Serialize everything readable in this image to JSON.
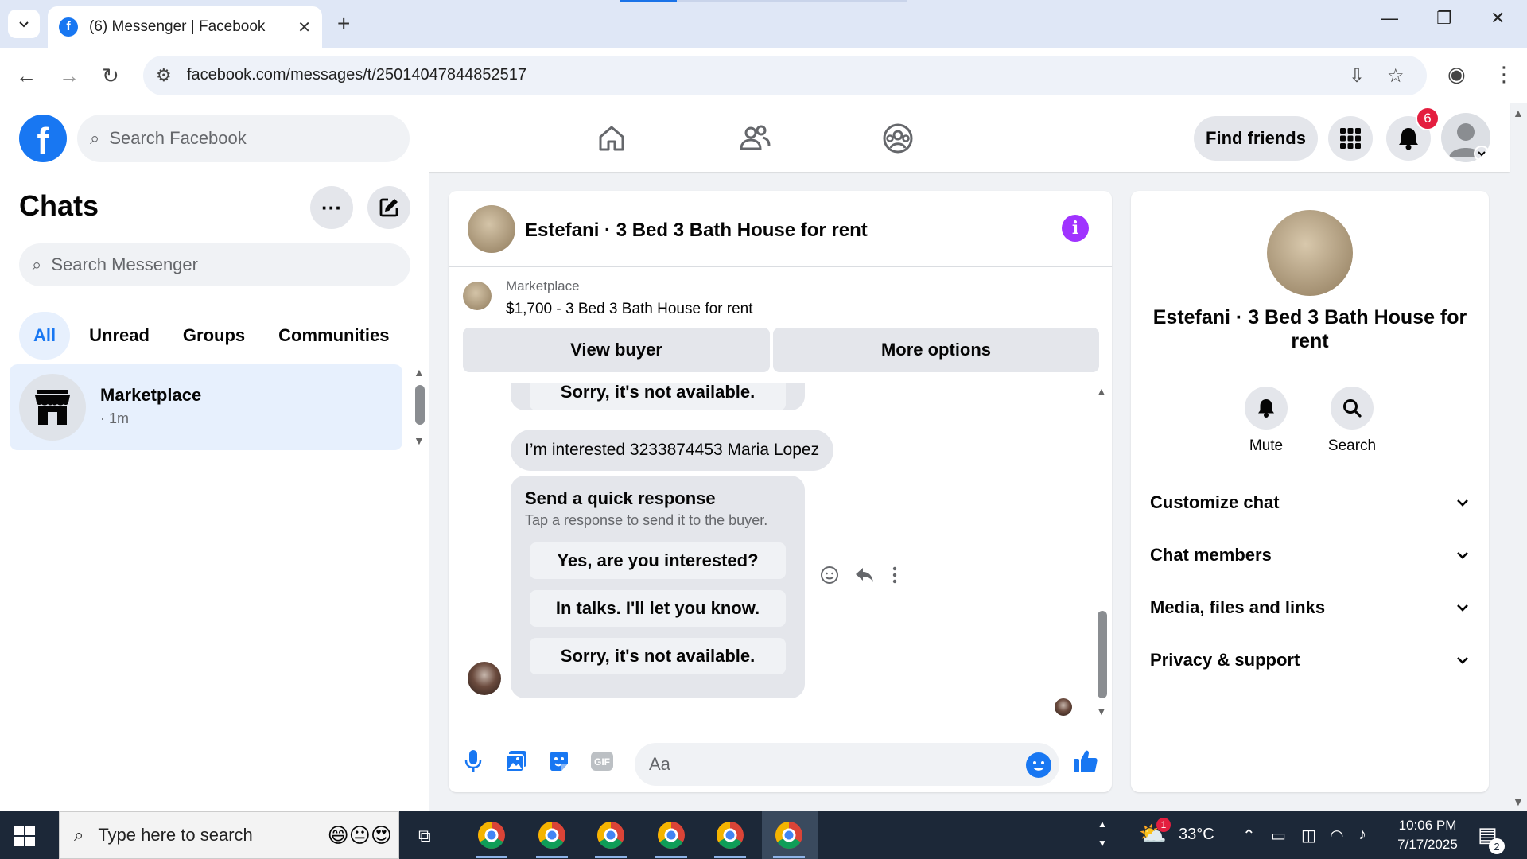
{
  "browser": {
    "tab_title": "(6) Messenger | Facebook",
    "url": "facebook.com/messages/t/25014047844852517"
  },
  "fb": {
    "search_placeholder": "Search Facebook",
    "find_friends": "Find friends",
    "notification_count": "6"
  },
  "sidebar": {
    "title": "Chats",
    "search_placeholder": "Search Messenger",
    "filters": [
      "All",
      "Unread",
      "Groups",
      "Communities"
    ],
    "active_filter": "All",
    "chats": [
      {
        "name": "Marketplace",
        "time": "· 1m"
      }
    ]
  },
  "conversation": {
    "title": "Estefani · 3 Bed 3 Bath House for rent",
    "marketplace_label": "Marketplace",
    "listing": "$1,700 - 3 Bed 3 Bath House for rent",
    "view_buyer": "View buyer",
    "more_options": "More options",
    "messages": {
      "prev_reply": "Sorry, it's not available.",
      "interested": "I’m interested 3233874453 Maria Lopez",
      "quick_title": "Send a quick response",
      "quick_sub": "Tap a response to send it to the buyer.",
      "quick_replies": [
        "Yes, are you interested?",
        "In talks. I'll let you know.",
        "Sorry, it's not available."
      ]
    },
    "composer_placeholder": "Aa"
  },
  "info_panel": {
    "name": "Estefani · 3 Bed 3 Bath House for rent",
    "mute": "Mute",
    "search": "Search",
    "rows": [
      "Customize chat",
      "Chat members",
      "Media, files and links",
      "Privacy & support"
    ]
  },
  "taskbar": {
    "search_placeholder": "Type here to search",
    "temperature": "33°C",
    "time": "10:06 PM",
    "date": "7/17/2025",
    "weather_badge": "1",
    "notif_count": "2"
  },
  "colors": {
    "facebook_blue": "#1877f2",
    "info_purple": "#a033ff",
    "badge_red": "#e41e3f"
  }
}
